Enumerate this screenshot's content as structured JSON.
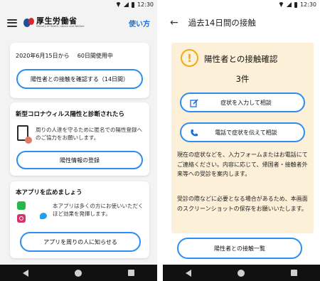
{
  "status": {
    "time": "12:30"
  },
  "left_screen": {
    "header": {
      "org_name": "厚生労働省",
      "org_sub": "Ministry of Health, Labour and Welfare",
      "howto_label": "使い方"
    },
    "usage": {
      "date": "2020年6月15日から",
      "days": "60日間使用中",
      "check_button": "陽性者との接触を確認する（14日間）"
    },
    "register": {
      "title": "新型コロナウィルス陽性と診断されたら",
      "description": "周りの人達を守るために匿名での陽性登録へのご協力をお願いします。",
      "button": "陽性情報の登録"
    },
    "share": {
      "title": "本アプリを広めましょう",
      "description": "本アプリは多くの方にお使いいただくほど効果を発揮します。",
      "button": "アプリを周りの人に知らせる"
    }
  },
  "right_screen": {
    "header": {
      "title": "過去14日間の接触"
    },
    "alert": {
      "icon_glyph": "!",
      "title": "陽性者との接触確認",
      "count": "3件",
      "symptom_button": "症状を入力して相談",
      "phone_button": "電話で症状を伝えて相談",
      "info1": "現在の症状などを、入力フォームまたはお電話にてご連絡ください。内容に応じて、帰国者・接触者外来等への受診を案内します。",
      "info2": "受診の際などに必要となる場合があるため、本画面のスクリーンショットの保存をお願いいたします。"
    },
    "list_button": "陽性者との接触一覧"
  },
  "colors": {
    "accent": "#2b8ef0",
    "link": "#1a6fd6",
    "alert_bg": "#fdf0d8",
    "alert_icon": "#f0a91b"
  }
}
